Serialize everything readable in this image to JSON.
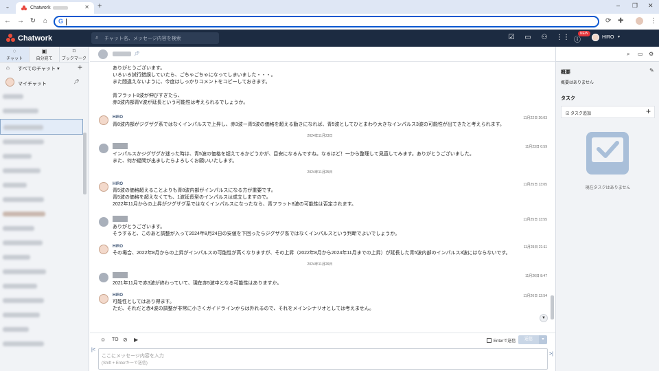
{
  "browser": {
    "tab_title": "Chatwork",
    "new_tab": "+",
    "menu": "⌄",
    "win_min": "–",
    "win_max": "❐",
    "win_close": "✕",
    "omnibox_g": "G"
  },
  "header": {
    "logo": "Chatwork",
    "search_placeholder": "チャット名、メッセージ内容を検索",
    "new_badge": "NEW",
    "user_name": "HIRO"
  },
  "sidebar": {
    "tabs": [
      {
        "label": "チャット",
        "icon": "chat-icon"
      },
      {
        "label": "自分宛て",
        "icon": "mention-icon"
      },
      {
        "label": "ブックマーク",
        "icon": "bookmark-icon"
      }
    ],
    "all_chats": "すべてのチャット",
    "my_chat": "マイチャット"
  },
  "messages": [
    {
      "kind": "cont",
      "lines": [
        "ありがとうございます。",
        "いろいろ試行錯誤していたら、ごちゃごちゃになってしまいました・・・。",
        "また間違えないように、今度はしっかりコメントをコピーしておきます。",
        "",
        "青フラット8波が伸びすぎたら、",
        "赤3波内部青V波が延長という可能性は考えられるでしょうか。"
      ]
    },
    {
      "kind": "hiro",
      "name": "HIRO",
      "time": "11月22日 20:03",
      "lines": [
        "青8波内部がジグザグ系ではなくインパルスで上昇し、赤3波ー青5波の価格を超える動きになれば、青5波としてひとまわり大きなインパルス3波の可能性が出てきたと考えられます。"
      ]
    },
    {
      "kind": "date",
      "text": "2024年11月23日"
    },
    {
      "kind": "gray",
      "time": "11月23日 0:59",
      "lines": [
        "インパルスかジグザグか迷った時は、青5波の価格を超えてるかどうかが、目安になるんですね。なるほど！一から整理して見直してみます。ありがとうございました。",
        "また、何か疑問が出ましたらよろしくお願いいたします。"
      ]
    },
    {
      "kind": "date",
      "text": "2024年11月25日"
    },
    {
      "kind": "hiro",
      "name": "HIRO",
      "time": "11月25日 13:05",
      "lines": [
        "青5波の価格超えることよりも青8波内部がインパルスになる方が重要です。",
        "青5波の価格を超えなくても、1波延長型のインパルスは成立しますので。",
        "2022年11月からの上昇がジグザグ系ではなくインパルスになったなら、青フラット8波の可能性は否定されます。"
      ]
    },
    {
      "kind": "gray",
      "time": "11月25日 13:55",
      "lines": [
        "ありがとうございます。",
        "そうすると、このあと調整が入って2024年8月24日の安値を下回ったらジグザグ系ではなくインパルスという判断でよいでしょうか。"
      ]
    },
    {
      "kind": "hiro",
      "name": "HIRO",
      "time": "11月25日 21:11",
      "lines": [
        "その場合、2022年8月からの上昇がインパルスの可能性が高くなりますが、その上昇（2022年8月から2024年11月までの上昇）が延長した青5波内部のインパルス3波にはならないです。"
      ]
    },
    {
      "kind": "date",
      "text": "2024年11月26日"
    },
    {
      "kind": "gray",
      "time": "11月26日 8:47",
      "lines": [
        "2021年11月で赤3波が終わっていて、現在赤5波中となる可能性はありますか。"
      ]
    },
    {
      "kind": "hiro",
      "name": "HIRO",
      "time": "11月26日 12:54",
      "lines": [
        "可能性としてはあり得ます。",
        "ただ、それだと赤4波の調整が非常に小さくガイドラインからは外れるので、それをメインシナリオとしては考えません。"
      ]
    }
  ],
  "composer": {
    "to_label": "TO",
    "enter_send": "Enterで送信",
    "send": "送信",
    "placeholder1": "ここにメッセージ内容を入力",
    "placeholder2": "(Shift + Enterキーで送信)",
    "collapse": "|<"
  },
  "rpanel": {
    "overview_title": "概要",
    "overview_empty": "概要はありません",
    "task_title": "タスク",
    "task_add": "タスク追加",
    "task_empty": "現在タスクはありません"
  },
  "colors": {
    "header_bg": "#1c2b41",
    "accent": "#3b5273",
    "logo": "#ea4c3a"
  }
}
